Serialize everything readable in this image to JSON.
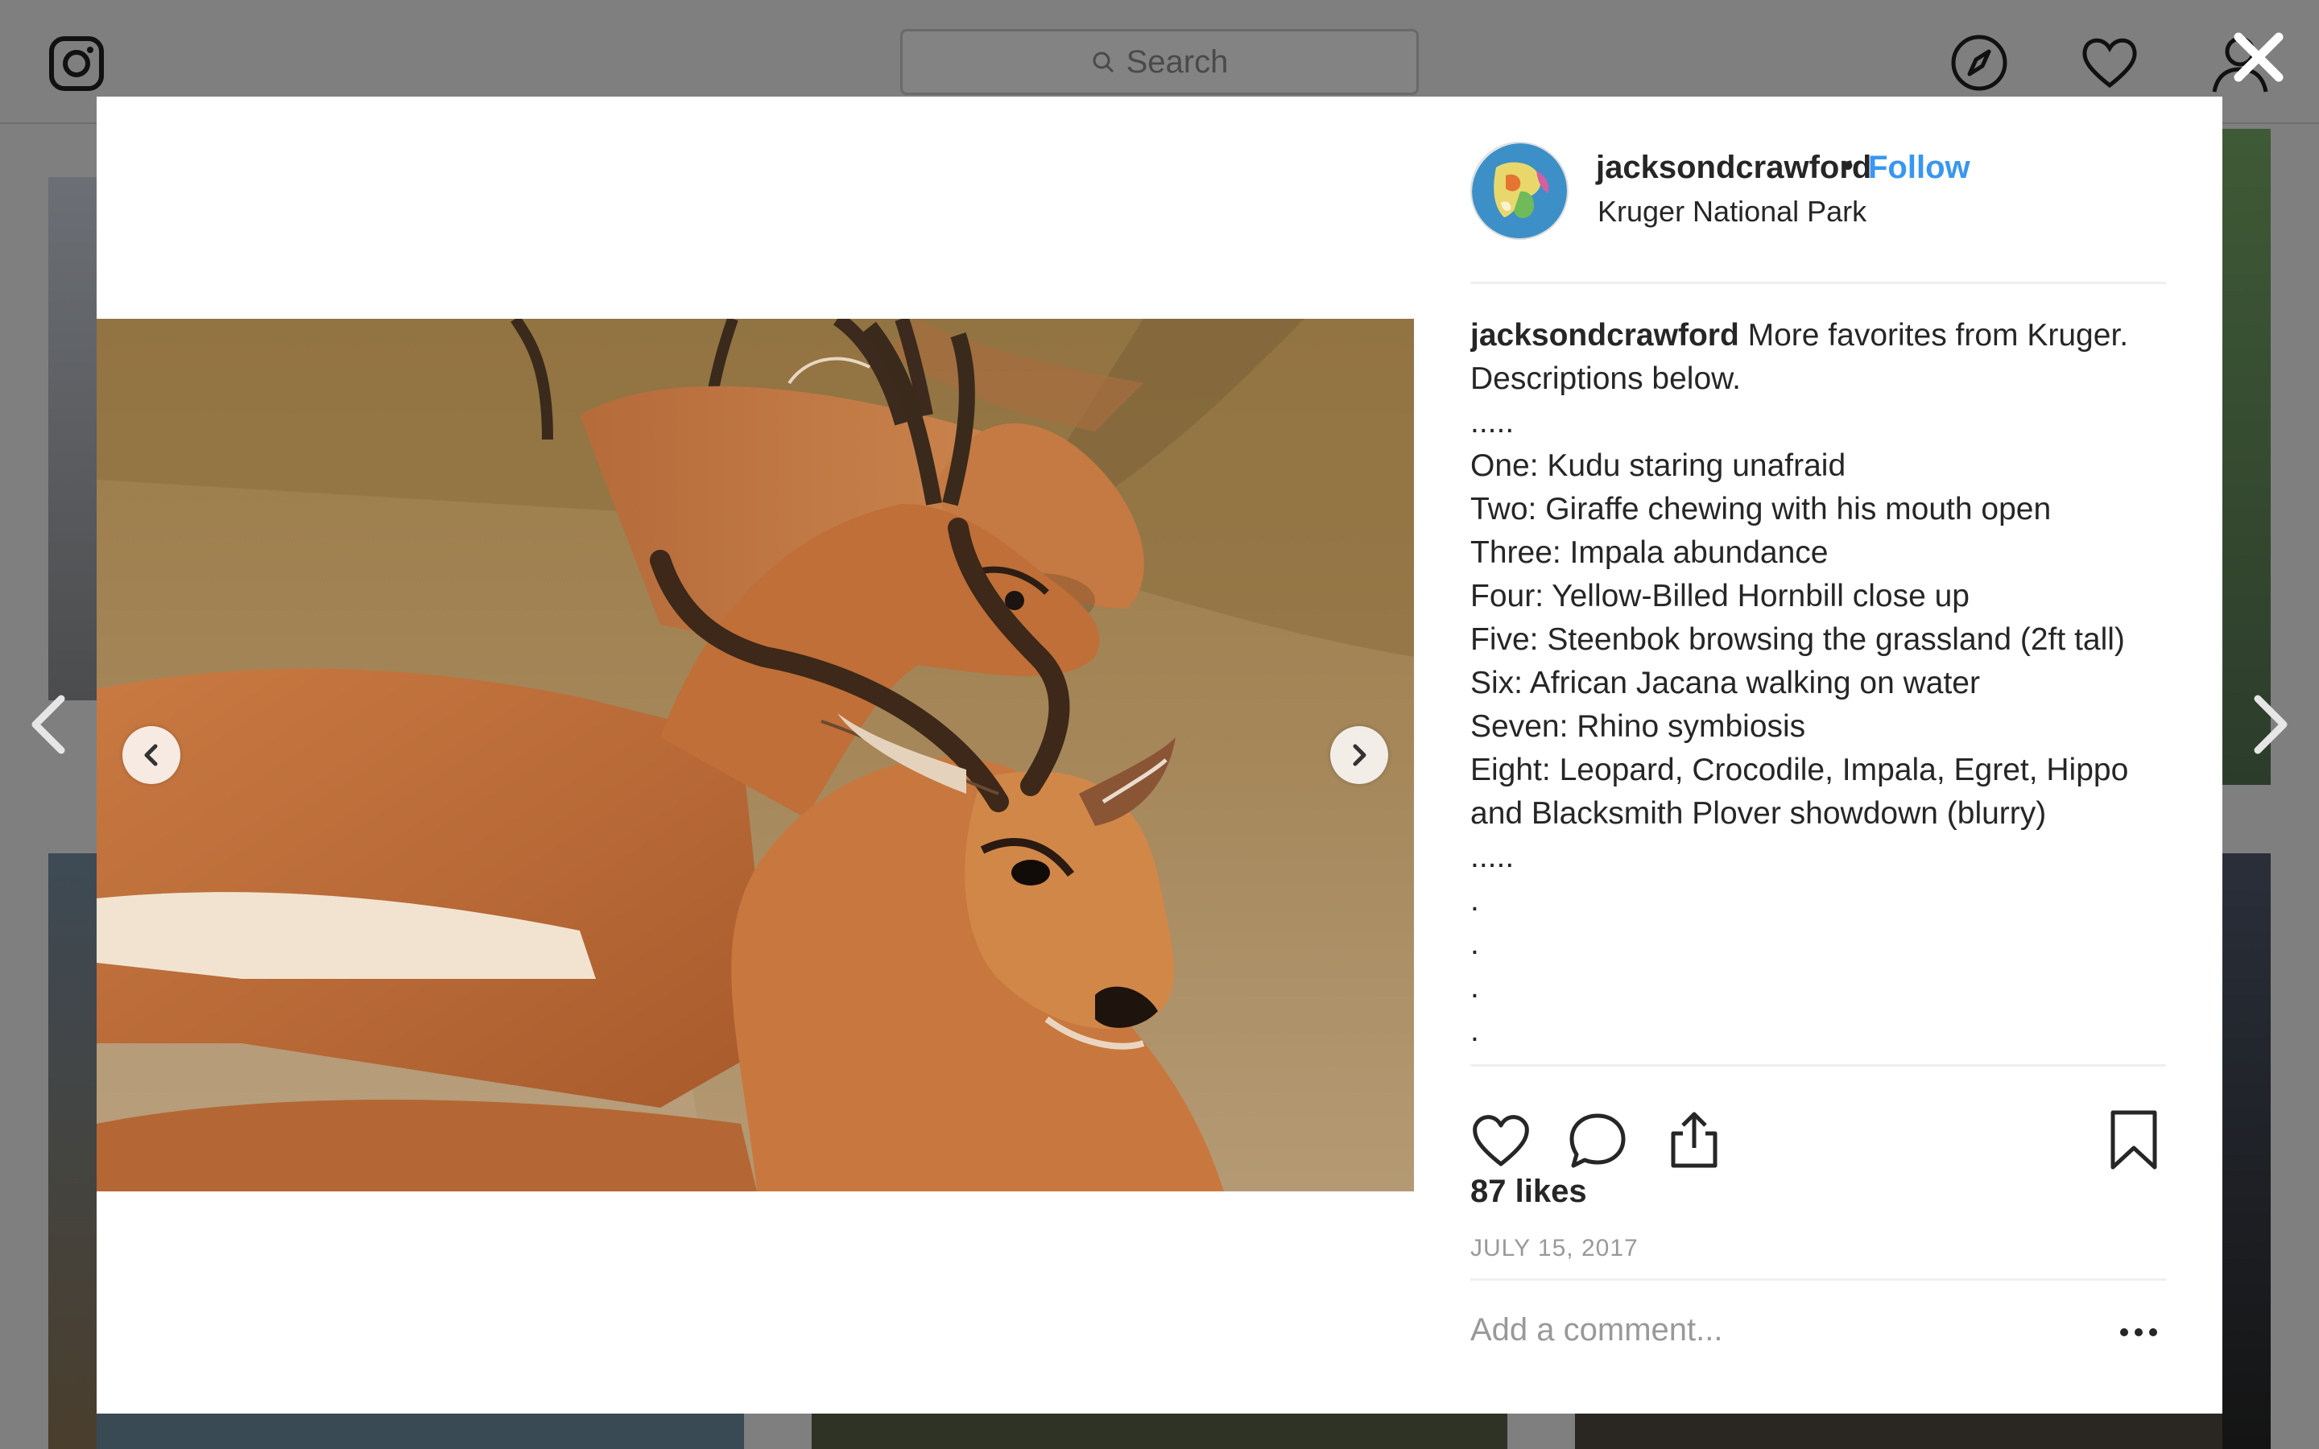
{
  "search": {
    "placeholder": "Search"
  },
  "post": {
    "username": "jacksondcrawford",
    "follow_label": "Follow",
    "location": "Kruger National Park",
    "caption_lines": [
      {
        "user": "jacksondcrawford",
        "text": " More favorites from Kruger."
      },
      {
        "user": "",
        "text": "Descriptions below."
      },
      {
        "user": "",
        "text": "....."
      },
      {
        "user": "",
        "text": "One: Kudu staring unafraid"
      },
      {
        "user": "",
        "text": "Two: Giraffe chewing with his mouth open"
      },
      {
        "user": "",
        "text": "Three: Impala abundance"
      },
      {
        "user": "",
        "text": "Four: Yellow-Billed Hornbill close up"
      },
      {
        "user": "",
        "text": "Five: Steenbok browsing the grassland (2ft tall)"
      },
      {
        "user": "",
        "text": "Six: African Jacana walking on water"
      },
      {
        "user": "",
        "text": "Seven: Rhino symbiosis"
      },
      {
        "user": "",
        "text": "Eight: Leopard, Crocodile, Impala, Egret, Hippo"
      },
      {
        "user": "",
        "text": "and Blacksmith Plover showdown (blurry)"
      },
      {
        "user": "",
        "text": "....."
      },
      {
        "user": "",
        "text": "."
      },
      {
        "user": "",
        "text": "."
      },
      {
        "user": "",
        "text": "."
      },
      {
        "user": "",
        "text": "."
      }
    ],
    "likes": "87 likes",
    "date": "JULY 15, 2017",
    "comment_placeholder": "Add a comment..."
  },
  "colors": {
    "link": "#3897f0",
    "text": "#262626",
    "muted": "#999999"
  }
}
